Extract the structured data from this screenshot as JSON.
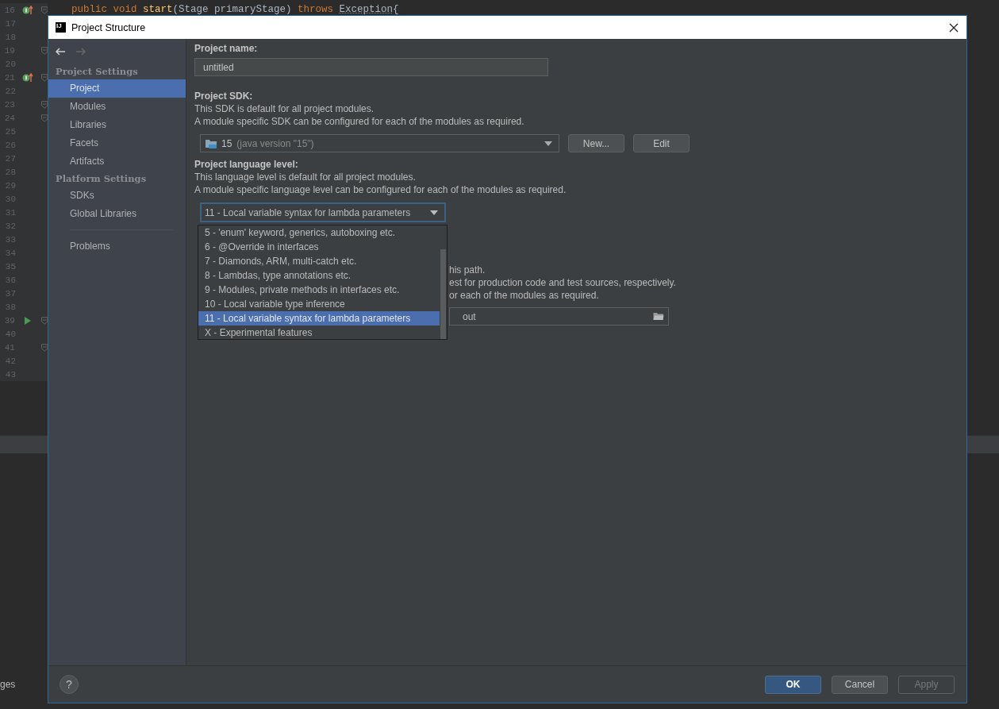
{
  "editor": {
    "code": [
      {
        "text": "public void ",
        "kind": "keyword"
      },
      {
        "text": "start",
        "kind": "method"
      },
      {
        "text": "(Stage primaryStage) ",
        "kind": "plain"
      },
      {
        "text": "throws ",
        "kind": "keyword"
      },
      {
        "text": "Exception",
        "kind": "type"
      },
      {
        "text": "{",
        "kind": "plain"
      }
    ],
    "lines": [
      {
        "number": "16",
        "kind": "implements",
        "fold": true
      },
      {
        "number": "17",
        "fold": false
      },
      {
        "number": "18",
        "fold": false
      },
      {
        "number": "19",
        "fold": true
      },
      {
        "number": "20",
        "fold": false
      },
      {
        "number": "21",
        "kind": "implements",
        "fold": true
      },
      {
        "number": "22",
        "fold": false
      },
      {
        "number": "23",
        "fold": true
      },
      {
        "number": "24",
        "fold": true
      },
      {
        "number": "25",
        "fold": false
      },
      {
        "number": "26",
        "fold": false
      },
      {
        "number": "27",
        "fold": false
      },
      {
        "number": "28",
        "fold": false
      },
      {
        "number": "29",
        "fold": false
      },
      {
        "number": "30",
        "fold": false
      },
      {
        "number": "31",
        "fold": false
      },
      {
        "number": "32",
        "fold": false
      },
      {
        "number": "33",
        "fold": false
      },
      {
        "number": "34",
        "fold": false
      },
      {
        "number": "35",
        "fold": false
      },
      {
        "number": "36",
        "fold": false
      },
      {
        "number": "37",
        "fold": false
      },
      {
        "number": "38",
        "fold": false
      },
      {
        "number": "39",
        "kind": "run",
        "fold": true
      },
      {
        "number": "40",
        "fold": false
      },
      {
        "number": "41",
        "fold": true
      },
      {
        "number": "42",
        "fold": false
      },
      {
        "number": "43",
        "fold": false
      }
    ],
    "status_fragment": "ges"
  },
  "dialog": {
    "logo": "IJ",
    "title": "Project Structure",
    "sidebar": {
      "sections": [
        {
          "header": "Project Settings",
          "items": [
            {
              "label": "Project",
              "selected": true
            },
            {
              "label": "Modules",
              "selected": false
            },
            {
              "label": "Libraries",
              "selected": false
            },
            {
              "label": "Facets",
              "selected": false
            },
            {
              "label": "Artifacts",
              "selected": false
            }
          ]
        },
        {
          "header": "Platform Settings",
          "items": [
            {
              "label": "SDKs",
              "selected": false
            },
            {
              "label": "Global Libraries",
              "selected": false
            }
          ]
        }
      ],
      "bottom_items": [
        {
          "label": "Problems",
          "selected": false
        }
      ]
    },
    "project_name": {
      "label": "Project name:",
      "value": "untitled"
    },
    "sdk": {
      "label": "Project SDK:",
      "descriptions": [
        "This SDK is default for all project modules.",
        "A module specific SDK can be configured for each of the modules as required."
      ],
      "value": "15",
      "detail": "(java version \"15\")",
      "buttons": [
        "New...",
        "Edit"
      ]
    },
    "language_level": {
      "label": "Project language level:",
      "descriptions": [
        "This language level is default for all project modules.",
        "A module specific language level can be configured for each of the modules as required."
      ],
      "value": "11 - Local variable syntax for lambda parameters",
      "options": [
        {
          "label": "5 - 'enum' keyword, generics, autoboxing etc.",
          "selected": false
        },
        {
          "label": "6 - @Override in interfaces",
          "selected": false
        },
        {
          "label": "7 - Diamonds, ARM, multi-catch etc.",
          "selected": false
        },
        {
          "label": "8 - Lambdas, type annotations etc.",
          "selected": false
        },
        {
          "label": "9 - Modules, private methods in interfaces etc.",
          "selected": false
        },
        {
          "label": "10 - Local variable type inference",
          "selected": false
        },
        {
          "label": "11 - Local variable syntax for lambda parameters",
          "selected": true
        },
        {
          "label": "X - Experimental features",
          "selected": false
        }
      ]
    },
    "compiler_output": {
      "lines": [
        {
          "right": "his path."
        },
        {
          "right": "est for production code and test sources, respectively."
        },
        {
          "right": "or each of the modules as required."
        }
      ],
      "path": "out"
    },
    "help": "?",
    "buttons": [
      {
        "label": "OK",
        "kind": "default"
      },
      {
        "label": "Cancel",
        "kind": "normal"
      },
      {
        "label": "Apply",
        "kind": "disabled"
      }
    ]
  }
}
